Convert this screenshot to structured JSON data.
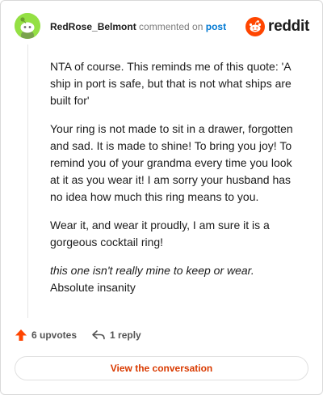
{
  "comment": {
    "username": "RedRose_Belmont",
    "action_text": "commented on",
    "post_link": "post"
  },
  "brand": {
    "wordmark": "reddit",
    "color": "#ff4500"
  },
  "body": {
    "p1": "NTA of course. This reminds me of this quote: 'A ship in port is safe, but that is not what ships are built for'",
    "p2": "Your ring is not made to sit in a drawer, forgotten and sad. It is made to shine! To bring you joy! To remind you of your grandma every time you look at it as you wear it! I am sorry your husband has no idea how much this ring means to you.",
    "p3": "Wear it, and wear it proudly, I am sure it is a gorgeous cocktail ring!",
    "quote": "this one isn't really mine to keep or wear.",
    "after_quote": "Absolute insanity"
  },
  "footer": {
    "upvotes": "6 upvotes",
    "replies": "1 reply"
  },
  "cta": {
    "label": "View the conversation"
  },
  "colors": {
    "avatar_bg": "#94e044",
    "upvote": "#ff4500",
    "link": "#0079d3",
    "cta_text": "#d93a00"
  }
}
